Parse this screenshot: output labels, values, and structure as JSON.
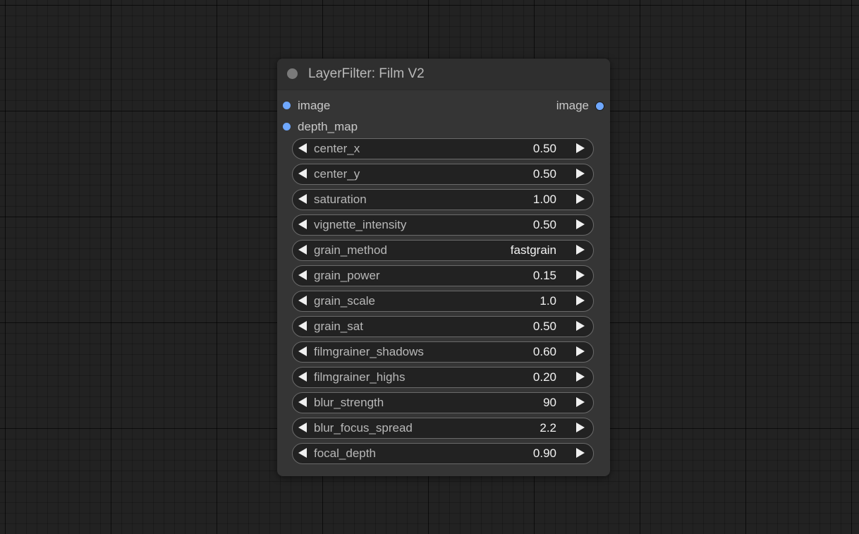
{
  "node": {
    "title": "LayerFilter: Film V2",
    "inputs": [
      {
        "label": "image",
        "color": "#6fa8ff"
      },
      {
        "label": "depth_map",
        "color": "#6fa8ff"
      }
    ],
    "outputs": [
      {
        "label": "image",
        "color": "#6fa8ff"
      }
    ],
    "widgets": [
      {
        "label": "center_x",
        "value": "0.50"
      },
      {
        "label": "center_y",
        "value": "0.50"
      },
      {
        "label": "saturation",
        "value": "1.00"
      },
      {
        "label": "vignette_intensity",
        "value": "0.50"
      },
      {
        "label": "grain_method",
        "value": "fastgrain"
      },
      {
        "label": "grain_power",
        "value": "0.15"
      },
      {
        "label": "grain_scale",
        "value": "1.0"
      },
      {
        "label": "grain_sat",
        "value": "0.50"
      },
      {
        "label": "filmgrainer_shadows",
        "value": "0.60"
      },
      {
        "label": "filmgrainer_highs",
        "value": "0.20"
      },
      {
        "label": "blur_strength",
        "value": "90"
      },
      {
        "label": "blur_focus_spread",
        "value": "2.2"
      },
      {
        "label": "focal_depth",
        "value": "0.90"
      }
    ]
  },
  "icons": {
    "collapse": "circle-dot-icon",
    "decrement": "triangle-left-icon",
    "increment": "triangle-right-icon"
  },
  "colors": {
    "canvas_background": "#222222",
    "node_body": "#353535",
    "node_title": "#2f2f2f",
    "widget_background": "#222222",
    "widget_border": "#6a6a6a",
    "slot_image": "#6fa8ff"
  }
}
